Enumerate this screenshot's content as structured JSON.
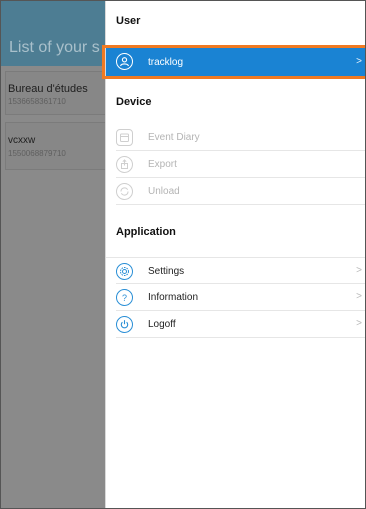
{
  "background": {
    "header_title": "List of your s",
    "cards": [
      {
        "name": "Bureau d'études",
        "sub": "1536658361710"
      },
      {
        "name": "vcxxw",
        "sub": "1550068879710"
      }
    ]
  },
  "drawer": {
    "sections": {
      "user": "User",
      "device": "Device",
      "application": "Application"
    },
    "user_items": [
      {
        "label": "tracklog",
        "icon": "user-icon",
        "chevron": ">"
      }
    ],
    "device_items": [
      {
        "label": "Event Diary",
        "icon": "calendar-icon"
      },
      {
        "label": "Export",
        "icon": "export-icon"
      },
      {
        "label": "Unload",
        "icon": "sync-icon"
      }
    ],
    "application_items": [
      {
        "label": "Settings",
        "icon": "gear-icon",
        "chevron": ">"
      },
      {
        "label": "Information",
        "icon": "question-icon",
        "chevron": ">"
      },
      {
        "label": "Logoff",
        "icon": "power-icon",
        "chevron": ">"
      }
    ]
  },
  "colors": {
    "accent": "#1a83d3",
    "highlight": "#f07a22",
    "header_bg": "#4d7d93"
  }
}
